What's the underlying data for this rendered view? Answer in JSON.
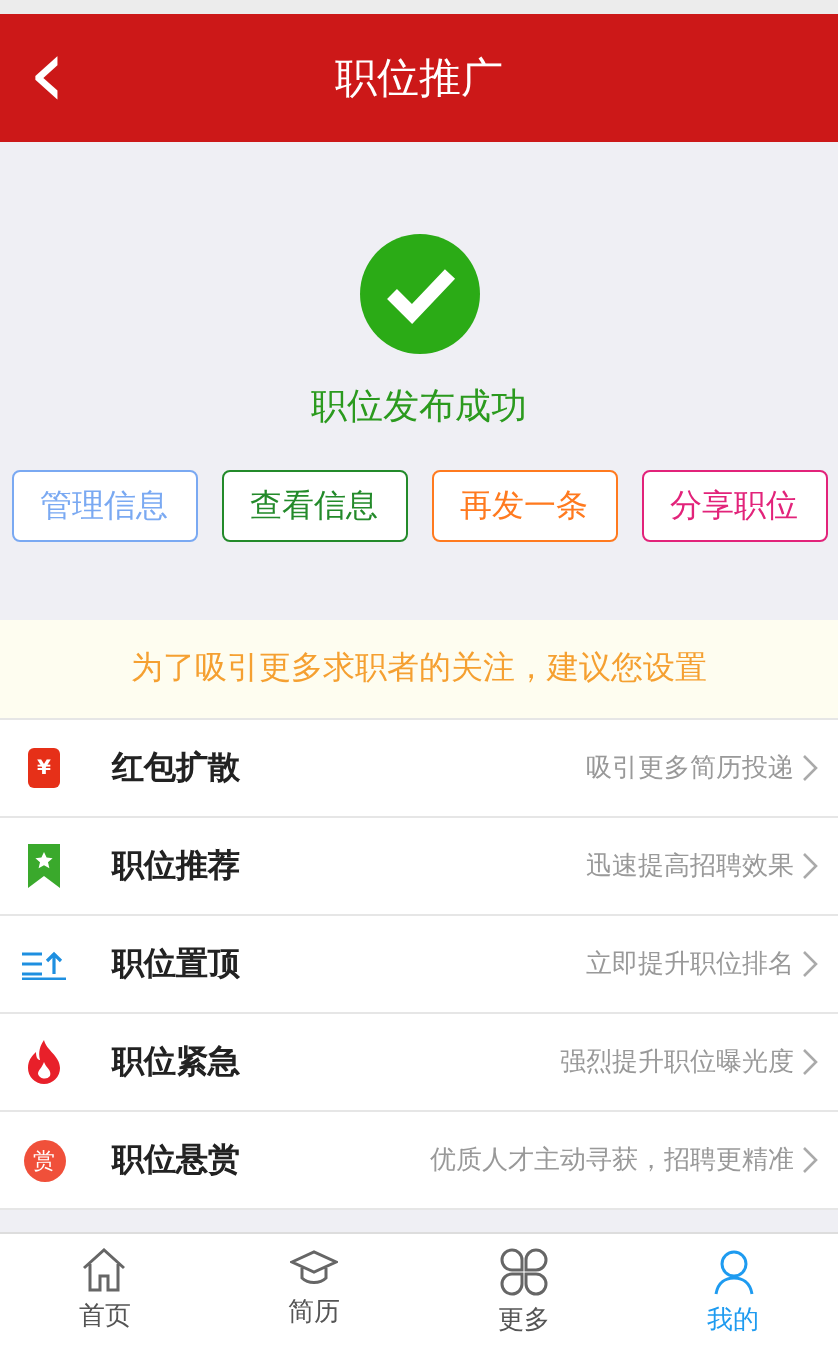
{
  "header": {
    "back": "‹",
    "title": "职位推广"
  },
  "result": {
    "message": "职位发布成功"
  },
  "actions": [
    {
      "label": "管理信息",
      "color": "#7aa9f2"
    },
    {
      "label": "查看信息",
      "color": "#238a2a"
    },
    {
      "label": "再发一条",
      "color": "#ff7a1f"
    },
    {
      "label": "分享职位",
      "color": "#e2237a"
    }
  ],
  "notice": "为了吸引更多求职者的关注，建议您设置",
  "options": [
    {
      "kind": "packet",
      "badge": "¥",
      "title": "红包扩散",
      "hint": "吸引更多简历投递"
    },
    {
      "kind": "bookmark",
      "title": "职位推荐",
      "hint": "迅速提高招聘效果"
    },
    {
      "kind": "top",
      "title": "职位置顶",
      "hint": "立即提升职位排名"
    },
    {
      "kind": "flame",
      "title": "职位紧急",
      "hint": "强烈提升职位曝光度"
    },
    {
      "kind": "reward",
      "badge": "赏",
      "title": "职位悬赏",
      "hint": "优质人才主动寻获，招聘更精准"
    }
  ],
  "tabbar": [
    {
      "kind": "home",
      "label": "首页",
      "selected": false
    },
    {
      "kind": "cap",
      "label": "简历",
      "selected": false
    },
    {
      "kind": "more",
      "label": "更多",
      "selected": false
    },
    {
      "kind": "user",
      "label": "我的",
      "selected": true
    }
  ]
}
